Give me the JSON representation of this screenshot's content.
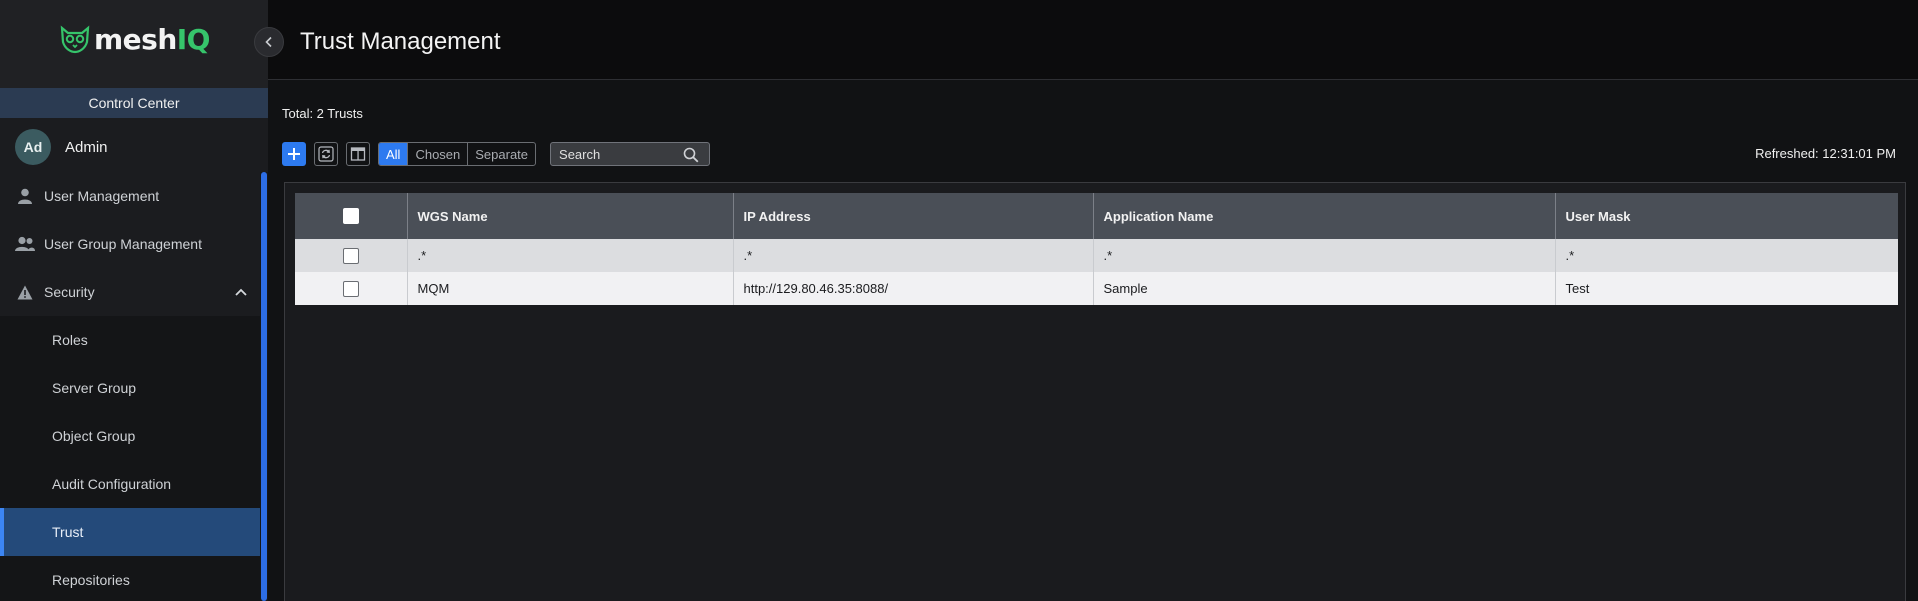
{
  "app": {
    "logo_text": "meshIQ",
    "logo_main": "mesh",
    "logo_accent": "IQ",
    "context": "Control Center"
  },
  "user": {
    "initials": "Ad",
    "name": "Admin"
  },
  "sidebar": {
    "items": [
      {
        "label": "User Management",
        "icon": "user-icon"
      },
      {
        "label": "User Group Management",
        "icon": "users-icon"
      },
      {
        "label": "Security",
        "icon": "warning-icon",
        "expanded": true
      }
    ],
    "security_children": [
      {
        "label": "Roles"
      },
      {
        "label": "Server Group"
      },
      {
        "label": "Object Group"
      },
      {
        "label": "Audit Configuration"
      },
      {
        "label": "Trust",
        "active": true
      },
      {
        "label": "Repositories"
      }
    ]
  },
  "page": {
    "title": "Trust Management",
    "total": "Total: 2 Trusts",
    "refreshed": "Refreshed: 12:31:01 PM"
  },
  "toolbar": {
    "add_icon": "plus-icon",
    "refresh_icon": "refresh-icon",
    "columns_icon": "columns-icon",
    "filters": [
      "All",
      "Chosen",
      "Separate"
    ],
    "active_filter": "All",
    "search_placeholder": "Search"
  },
  "table": {
    "columns": [
      "WGS Name",
      "IP Address",
      "Application Name",
      "User Mask"
    ],
    "filter_row": [
      ".*",
      ".*",
      ".*",
      ".*"
    ],
    "rows": [
      [
        "MQM",
        "http://129.80.46.35:8088/",
        "Sample",
        "Test"
      ]
    ]
  },
  "colors": {
    "accent": "#2d7af0",
    "active_nav": "#244a7a",
    "brand_green": "#36c46b"
  }
}
